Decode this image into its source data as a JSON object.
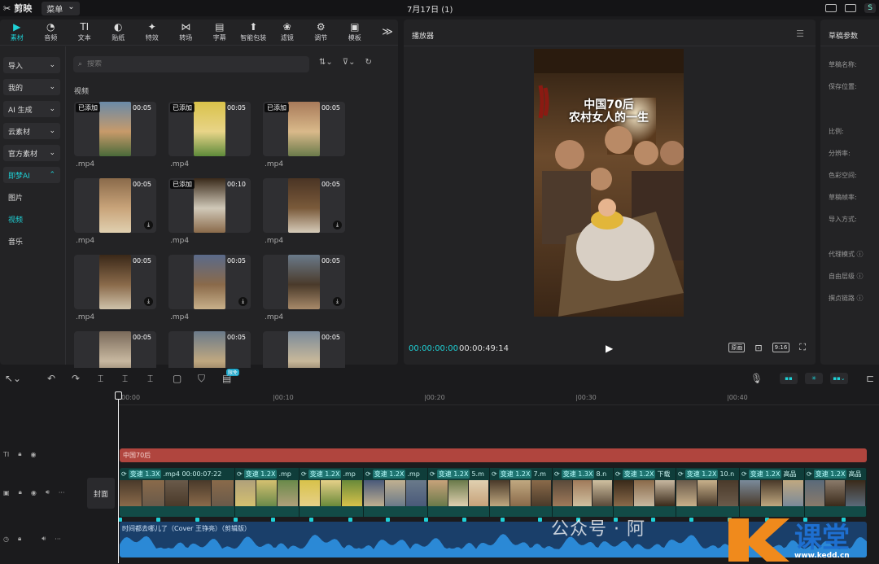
{
  "titlebar": {
    "app_name": "剪映",
    "menu_label": "菜单",
    "window_title": "7月17日 (1)",
    "user_label": "S"
  },
  "tabs": [
    {
      "label": "素材",
      "glyph": "▶"
    },
    {
      "label": "音频",
      "glyph": "◔"
    },
    {
      "label": "文本",
      "glyph": "TI"
    },
    {
      "label": "贴纸",
      "glyph": "◐"
    },
    {
      "label": "特效",
      "glyph": "✦"
    },
    {
      "label": "转场",
      "glyph": "⋈"
    },
    {
      "label": "字幕",
      "glyph": "▤"
    },
    {
      "label": "智能包装",
      "glyph": "⬆"
    },
    {
      "label": "滤镜",
      "glyph": "❀"
    },
    {
      "label": "调节",
      "glyph": "⚙"
    },
    {
      "label": "模板",
      "glyph": "▣"
    }
  ],
  "tabs_more": "≫",
  "sidebar": {
    "items": [
      {
        "label": "导入"
      },
      {
        "label": "我的"
      },
      {
        "label": "AI 生成"
      },
      {
        "label": "云素材"
      },
      {
        "label": "官方素材"
      },
      {
        "label": "即梦AI"
      }
    ],
    "sub_items": [
      {
        "label": "图片"
      },
      {
        "label": "视频"
      },
      {
        "label": "音乐"
      }
    ]
  },
  "search": {
    "placeholder": "搜索"
  },
  "section_label": "视频",
  "media": [
    {
      "added": "已添加",
      "duration": "00:05",
      "name": ".mp4",
      "download": false
    },
    {
      "added": "已添加",
      "duration": "00:05",
      "name": ".mp4",
      "download": false
    },
    {
      "added": "已添加",
      "duration": "00:05",
      "name": ".mp4",
      "download": false
    },
    {
      "added": "",
      "duration": "00:05",
      "name": ".mp4",
      "download": true
    },
    {
      "added": "已添加",
      "duration": "00:10",
      "name": ".mp4",
      "download": false
    },
    {
      "added": "",
      "duration": "00:05",
      "name": ".mp4",
      "download": true
    },
    {
      "added": "",
      "duration": "00:05",
      "name": ".mp4",
      "download": true
    },
    {
      "added": "",
      "duration": "00:05",
      "name": ".mp4",
      "download": true
    },
    {
      "added": "",
      "duration": "00:05",
      "name": ".mp4",
      "download": true
    },
    {
      "added": "",
      "duration": "00:05",
      "name": "",
      "download": false
    },
    {
      "added": "",
      "duration": "00:05",
      "name": "",
      "download": false
    },
    {
      "added": "",
      "duration": "00:05",
      "name": "",
      "download": false
    }
  ],
  "player": {
    "title": "播放器",
    "video_title_line1": "中国70后",
    "video_title_line2": "农村女人的一生",
    "current_time": "00:00:00:00",
    "total_time": "00:00:49:14",
    "btn_original": "原画",
    "btn_ratio": "9:16"
  },
  "props": {
    "title": "草稿参数",
    "rows": [
      "草稿名称:",
      "保存位置:",
      "比例:",
      "分辨率:",
      "色彩空间:",
      "草稿帧率:",
      "导入方式:",
      "代理模式 ⓘ",
      "自由层级 ⓘ",
      "撰贞链路 ⓘ"
    ]
  },
  "timeline": {
    "badge": "限免",
    "ruler": [
      "00:00",
      "|00:10",
      "|00:20",
      "|00:30",
      "|00:40"
    ],
    "cover_label": "封面",
    "text_clip": "中国70后",
    "video_clips": [
      {
        "speed": "变速 1.3X",
        "name": ".mp4  00:00:07:22"
      },
      {
        "speed": "变速 1.2X",
        "name": ".mp"
      },
      {
        "speed": "变速 1.2X",
        "name": ".mp"
      },
      {
        "speed": "变速 1.2X",
        "name": ".mp"
      },
      {
        "speed": "变速 1.2X",
        "name": "5.m"
      },
      {
        "speed": "变速 1.2X",
        "name": "7.m"
      },
      {
        "speed": "变速 1.3X",
        "name": "8.n"
      },
      {
        "speed": "变速 1.2X",
        "name": "下载"
      },
      {
        "speed": "变速 1.2X",
        "name": "10.n"
      },
      {
        "speed": "变速 1.2X",
        "name": "高品"
      },
      {
        "speed": "变速 1.2X",
        "name": "高品"
      }
    ],
    "audio_clip": "时间都去哪儿了（Cover 王铮亮）（剪辑版）"
  },
  "watermark": {
    "text": "公众号 · 阿",
    "logo_text": "课堂",
    "logo_url": "www.kedd.cn"
  }
}
